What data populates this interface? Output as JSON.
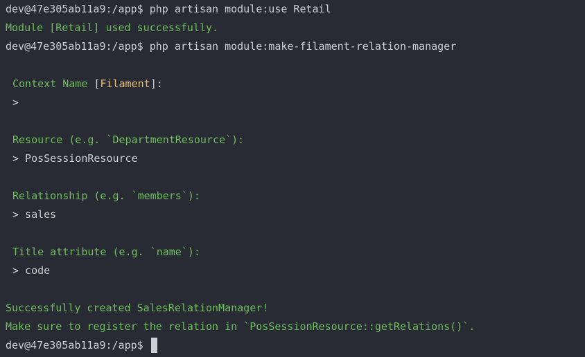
{
  "terminal": {
    "prompt": "dev@47e305ab11a9:/app$ ",
    "cmd1": "php artisan module:use Retail",
    "out1": "Module [Retail] used successfully.",
    "cmd2": "php artisan module:make-filament-relation-manager",
    "context": {
      "label": "Context Name",
      "default_open": "[",
      "default_value": "Filament",
      "default_close": "]:",
      "input": ">"
    },
    "resource": {
      "label": "Resource (e.g. `DepartmentResource`):",
      "input": "> PosSessionResource"
    },
    "relationship": {
      "label": "Relationship (e.g. `members`):",
      "input": "> sales"
    },
    "title_attribute": {
      "label": "Title attribute (e.g. `name`):",
      "input": "> code"
    },
    "success": "Successfully created SalesRelationManager!",
    "register_note": "Make sure to register the relation in `PosSessionResource::getRelations()`.",
    "colors": {
      "background": "#282b33",
      "text": "#cdd1d6",
      "green": "#6fbe5e",
      "yellow": "#e6c07b"
    }
  }
}
